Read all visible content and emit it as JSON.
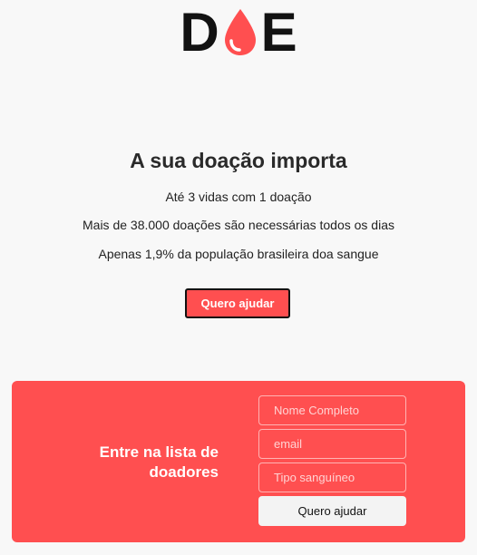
{
  "logo": {
    "letter_left": "D",
    "letter_right": "E",
    "drop_icon": "blood-drop-icon",
    "colors": {
      "letters": "#121212",
      "drop": "#ff4f50"
    }
  },
  "hero": {
    "title": "A sua doação importa",
    "line1": "Até 3 vidas com 1 doação",
    "line2": "Mais de 38.000 doações são necessárias todos os dias",
    "line3": "Apenas 1,9% da população brasileira doa sangue",
    "cta_label": "Quero ajudar"
  },
  "signup": {
    "title_line1": "Entre na lista de",
    "title_line2": "doadores",
    "name_placeholder": "Nome Completo",
    "email_placeholder": "email",
    "blood_type_placeholder": "Tipo sanguíneo",
    "submit_label": "Quero ajudar"
  },
  "colors": {
    "accent": "#ff4f50",
    "background": "#f8f8f8",
    "submit_bg": "#f3f3f3"
  }
}
